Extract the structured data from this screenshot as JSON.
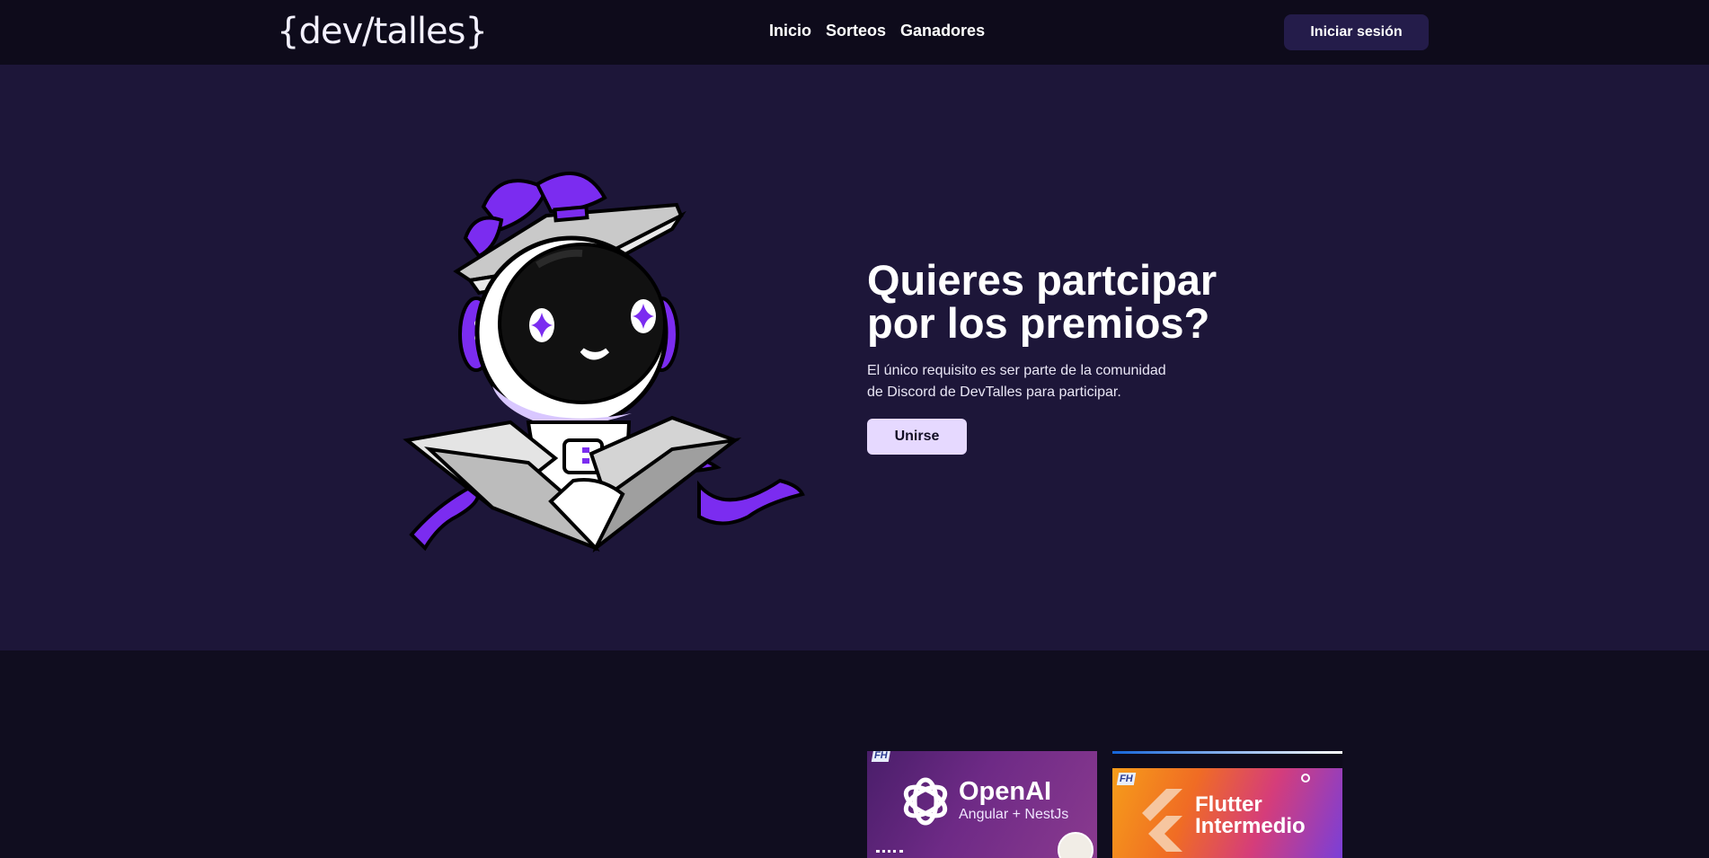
{
  "navbar": {
    "logo": "{dev/talles}",
    "links": [
      "Inicio",
      "Sorteos",
      "Ganadores"
    ],
    "login_label": "Iniciar sesión"
  },
  "hero": {
    "title": "Quieres partcipar por los premios?",
    "description": "El único requisito es ser parte de la comunidad de Discord de DevTalles para participar.",
    "join_label": "Unirse"
  },
  "courses": [
    {
      "title": "OpenAI",
      "subtitle": "Angular + NestJs",
      "badge": "FH"
    },
    {
      "title": "Flutter Intermedio",
      "badge": "FH"
    }
  ],
  "colors": {
    "navbar_bg": "#0e0b1b",
    "hero_bg": "#1d1639",
    "accent_purple": "#7b2cf0",
    "join_button_bg": "#e6d9ff",
    "login_button_bg": "#241c4a"
  },
  "icons": [
    "astronaut-gift-illustration",
    "openai-logo-icon",
    "flutter-logo-icon"
  ]
}
